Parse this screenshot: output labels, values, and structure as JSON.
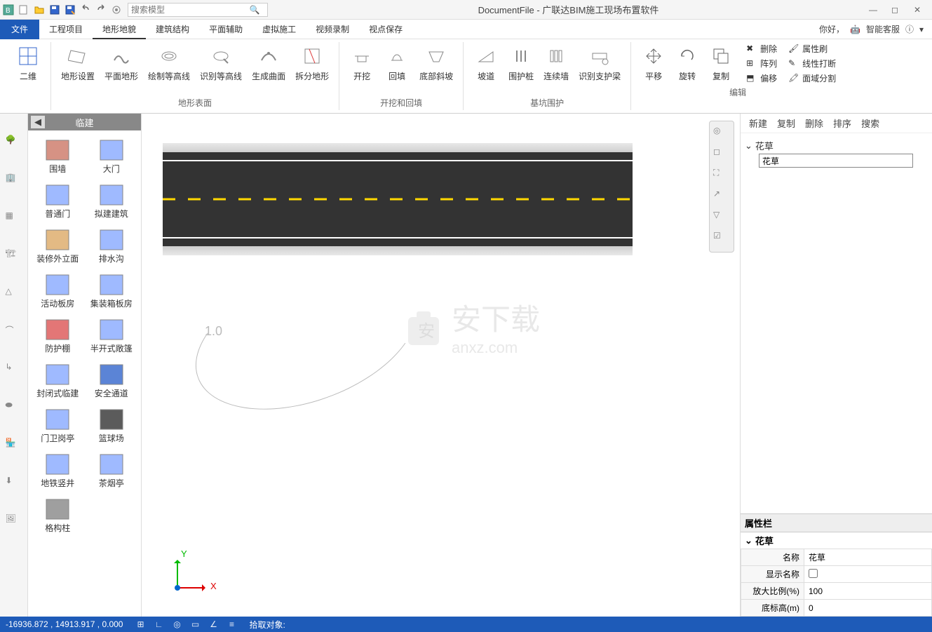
{
  "title": "DocumentFile - 广联达BIM施工现场布置软件",
  "search_placeholder": "搜索模型",
  "menu": {
    "file": "文件",
    "items": [
      "工程项目",
      "地形地貌",
      "建筑结构",
      "平面辅助",
      "虚拟施工",
      "视频录制",
      "视点保存"
    ],
    "active_idx": 1,
    "right_greeting": "你好，",
    "right_service": "智能客服"
  },
  "ribbon": {
    "g1": {
      "items": [
        "二维"
      ],
      "label": ""
    },
    "g2": {
      "items": [
        "地形设置",
        "平面地形",
        "绘制等高线",
        "识别等高线",
        "生成曲面",
        "拆分地形"
      ],
      "label": "地形表面"
    },
    "g3": {
      "items": [
        "开挖",
        "回填",
        "底部斜坡"
      ],
      "label": "开挖和回填"
    },
    "g4": {
      "items": [
        "坡道",
        "围护桩",
        "连续墙",
        "识别支护梁"
      ],
      "label": "基坑围护"
    },
    "g5": {
      "items": [
        "平移",
        "旋转",
        "复制"
      ],
      "label": "编辑",
      "small": [
        "删除",
        "阵列",
        "偏移",
        "属性刷",
        "线性打断",
        "面域分割"
      ]
    }
  },
  "palette": {
    "title": "临建",
    "items": [
      "围墙",
      "大门",
      "普通门",
      "拟建建筑",
      "装修外立面",
      "排水沟",
      "活动板房",
      "集装箱板房",
      "防护棚",
      "半开式敞篷",
      "封闭式临建",
      "安全通道",
      "门卫岗亭",
      "篮球场",
      "地铁竖井",
      "茶烟亭",
      "格构柱"
    ]
  },
  "viewport": {
    "curve_label": "1.0",
    "axis_y": "Y",
    "axis_x": "X",
    "watermark_main": "安下载",
    "watermark_sub": "anxz.com"
  },
  "tree": {
    "toolbar": [
      "新建",
      "复制",
      "删除",
      "排序",
      "搜索"
    ],
    "root": "花草",
    "input_value": "花草"
  },
  "props": {
    "header": "属性栏",
    "section": "花草",
    "rows": [
      {
        "k": "名称",
        "v": "花草"
      },
      {
        "k": "显示名称",
        "v": "checkbox"
      },
      {
        "k": "放大比例(%)",
        "v": "100"
      },
      {
        "k": "底标高(m)",
        "v": "0"
      }
    ]
  },
  "status": {
    "coords": "-16936.872 , 14913.917 , 0.000",
    "pick": "拾取对象:"
  }
}
